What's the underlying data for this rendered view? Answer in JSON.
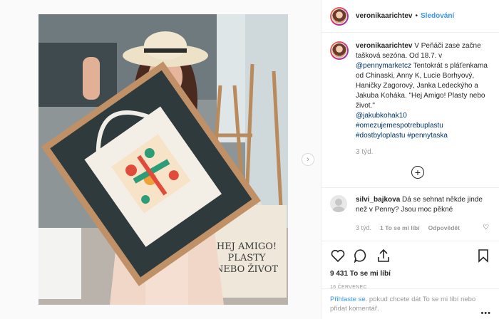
{
  "post": {
    "author": "veronikaarichtev",
    "follow_label": "Sledování",
    "dot": "•"
  },
  "caption": {
    "author": "veronikaarichtev",
    "text_1": "V Peňáči zase začne tašková sezóna. Od 18.7. v",
    "mention_1": "@pennymarketcz",
    "text_2": "Tentokrát s pláťenkama od Chinaski, Anny K, Lucie Borhyový, Haničky Zagorový, Janka Ledeckýho a Jakuba Koháka. \"Hej Amigo! Plasty nebo život.\"",
    "mention_2": "@jakubkohak10",
    "hashtag_1": "#omezujemespotrebuplastu",
    "hashtag_2": "#dostbyloplastu",
    "hashtag_3": "#pennytaska",
    "time": "3 týd."
  },
  "comment": {
    "author": "silvi_bajkova",
    "text": "Dá se sehnat někde jinde než v Penny? Jsou moc pěkné",
    "time": "3 týd.",
    "likes": "1 To se mi líbí",
    "reply": "Odpovědět"
  },
  "stats": {
    "likes": "9 431 To se mi líbí",
    "date": "16 ČERVENEC"
  },
  "login": {
    "link": "Přihlaste se.",
    "text": " pokud chcete dát To se mi líbí nebo přidat komentář.",
    "more": "•••"
  },
  "photo": {
    "bag_text": "HEJ AMIGO! PLASTY NEBO ŽIVOT"
  },
  "icons": {
    "next": "chevron-right-icon",
    "load_more": "plus-circle-icon",
    "like": "heart-icon",
    "comment": "comment-icon",
    "share": "share-icon",
    "save": "bookmark-icon",
    "options": "more-icon"
  }
}
